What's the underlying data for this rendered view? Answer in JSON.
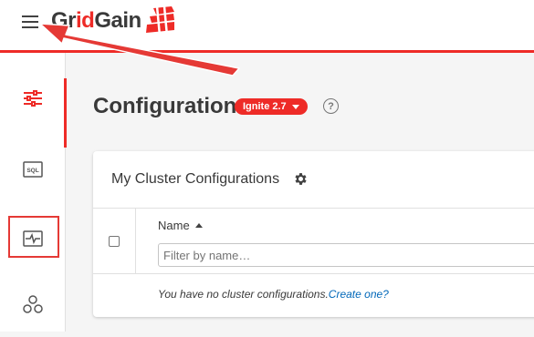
{
  "header": {
    "logo_prefix": "Gr",
    "logo_highlight": "id",
    "logo_suffix": "Gain"
  },
  "sidebar": {
    "items": [
      {
        "icon": "sliders-icon"
      },
      {
        "icon": "sql-icon",
        "label": "SQL"
      },
      {
        "icon": "monitoring-icon"
      },
      {
        "icon": "cluster-icon"
      }
    ]
  },
  "page": {
    "title": "Configuration",
    "version": "Ignite 2.7",
    "help": "?"
  },
  "card": {
    "title": "My Cluster Configurations",
    "column_name": "Name",
    "filter_placeholder": "Filter by name…",
    "empty_text": "You have no cluster configurations.",
    "create_link": "Create one?"
  },
  "colors": {
    "accent": "#ee2b27",
    "link": "#0067b9",
    "text": "#393939",
    "annotation_arrow": "#e53935"
  }
}
